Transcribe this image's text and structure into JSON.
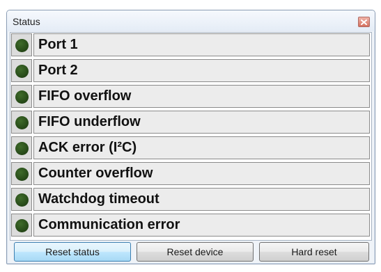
{
  "window": {
    "title": "Status"
  },
  "status_items": [
    {
      "label": "Port 1"
    },
    {
      "label": "Port 2"
    },
    {
      "label": "FIFO overflow"
    },
    {
      "label": "FIFO underflow"
    },
    {
      "label": "ACK error (I²C)"
    },
    {
      "label": "Counter overflow"
    },
    {
      "label": "Watchdog timeout"
    },
    {
      "label": "Communication error"
    }
  ],
  "buttons": {
    "reset_status": "Reset status",
    "reset_device": "Reset device",
    "hard_reset": "Hard reset"
  },
  "colors": {
    "led_off": "#2a4f1b",
    "close_button": "#d4705e"
  }
}
